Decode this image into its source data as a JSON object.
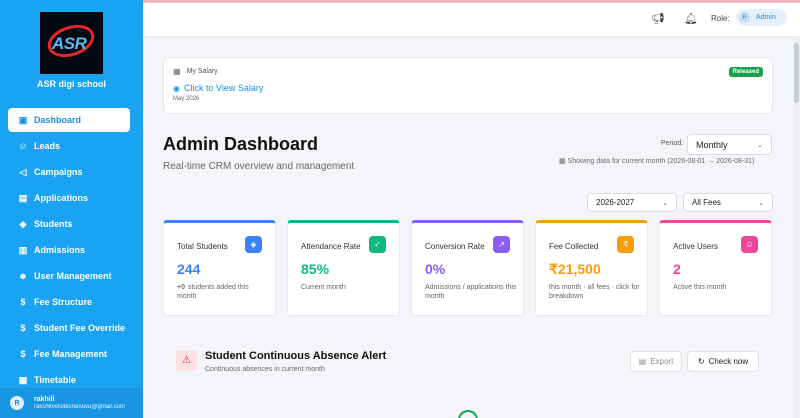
{
  "sidebar": {
    "logo_text": "ASR",
    "school_name": "ASR digi school",
    "items": [
      {
        "label": "Dashboard",
        "icon": "dashboard-icon",
        "glyph": "▣"
      },
      {
        "label": "Leads",
        "icon": "users-icon",
        "glyph": "☺"
      },
      {
        "label": "Campaigns",
        "icon": "megaphone-icon",
        "glyph": "◁"
      },
      {
        "label": "Applications",
        "icon": "document-icon",
        "glyph": "▤"
      },
      {
        "label": "Students",
        "icon": "graduation-cap-icon",
        "glyph": "◈"
      },
      {
        "label": "Admissions",
        "icon": "building-icon",
        "glyph": "▥"
      },
      {
        "label": "User Management",
        "icon": "user-cog-icon",
        "glyph": "☻"
      },
      {
        "label": "Fee Structure",
        "icon": "dollar-icon",
        "glyph": "$"
      },
      {
        "label": "Student Fee Override",
        "icon": "dollar-icon",
        "glyph": "$"
      },
      {
        "label": "Fee Management",
        "icon": "dollar-icon",
        "glyph": "$"
      },
      {
        "label": "Timetable",
        "icon": "calendar-icon",
        "glyph": "▦"
      }
    ],
    "user": {
      "initial": "R",
      "name": "rakhili",
      "email": "rakshitvelsitechenuvu@gmail.com"
    }
  },
  "topbar": {
    "role_label": "Role:",
    "role_initial": "R",
    "role_value": "Admin"
  },
  "salary": {
    "title": "My Salary",
    "link": "Click to View Salary",
    "month": "May 2026",
    "badge": "Released"
  },
  "header": {
    "title": "Admin Dashboard",
    "subtitle": "Real-time CRM overview and management",
    "period_label": "Period:",
    "period_value": "Monthly",
    "date_info": "Showing data for current month (2026-08-01 → 2026-08-31)",
    "year_value": "2026-2027",
    "fee_filter": "All Fees"
  },
  "stats": [
    {
      "label": "Total Students",
      "value": "244",
      "prefix": "+0",
      "note": "students added this month",
      "color": "#3b82f6",
      "icon": "graduation-cap-icon",
      "glyph": "◈"
    },
    {
      "label": "Attendance Rate",
      "value": "85%",
      "prefix": "",
      "note": "Current month",
      "color": "#10b981",
      "icon": "user-check-icon",
      "glyph": "✓"
    },
    {
      "label": "Conversion Rate",
      "value": "0%",
      "prefix": "",
      "note": "Admissions / applications this month",
      "color": "#8b5cf6",
      "icon": "trend-up-icon",
      "glyph": "↗"
    },
    {
      "label": "Fee Collected",
      "value": "₹21,500",
      "prefix": "",
      "note": "this month · all fees · click for breakdown",
      "color": "#f59e0b",
      "icon": "rupee-icon",
      "glyph": "₹"
    },
    {
      "label": "Active Users",
      "value": "2",
      "prefix": "",
      "note": "Active this month",
      "color": "#ec4899",
      "icon": "users-icon",
      "glyph": "☺"
    }
  ],
  "alert": {
    "title": "Student Continuous Absence Alert",
    "subtitle": "Continuous absences in current month",
    "export": "Export",
    "check": "Check now"
  }
}
